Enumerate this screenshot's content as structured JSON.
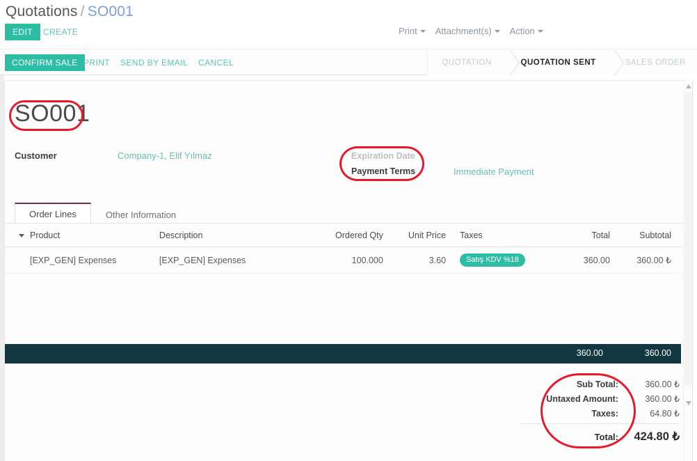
{
  "breadcrumb": {
    "root": "Quotations",
    "separator": "/",
    "current": "SO001"
  },
  "header": {
    "edit_label": "EDIT",
    "create_label": "CREATE",
    "menus": [
      {
        "label": "Print",
        "icon": "chevron-down-icon"
      },
      {
        "label": "Attachment(s)",
        "icon": "chevron-down-icon"
      },
      {
        "label": "Action",
        "icon": "chevron-down-icon"
      }
    ]
  },
  "statusbar": {
    "primary_action": "CONFIRM SALE",
    "actions": [
      {
        "label": "PRINT"
      },
      {
        "label": "SEND BY EMAIL"
      },
      {
        "label": "CANCEL"
      }
    ],
    "pipeline": [
      {
        "label": "QUOTATION",
        "active": false
      },
      {
        "label": "QUOTATION SENT",
        "active": true
      },
      {
        "label": "SALES ORDER",
        "active": false
      }
    ]
  },
  "document": {
    "title": "SO001",
    "fields": {
      "customer_label": "Customer",
      "customer_value": "Company-1, Elif Yılmaz",
      "expiration_label": "Expiration Date",
      "expiration_value": "",
      "payment_terms_label": "Payment Terms",
      "payment_terms_value": "Immediate Payment"
    }
  },
  "tabs": [
    {
      "label": "Order Lines",
      "active": true
    },
    {
      "label": "Other Information",
      "active": false
    }
  ],
  "lines_table": {
    "columns": [
      "Product",
      "Description",
      "Ordered Qty",
      "Unit Price",
      "Taxes",
      "Total",
      "Subtotal"
    ],
    "rows": [
      {
        "product": "[EXP_GEN] Expenses",
        "description": "[EXP_GEN] Expenses",
        "ordered_qty": "100.000",
        "unit_price": "3.60",
        "taxes": "Satış KDV %18",
        "total": "360.00",
        "subtotal": "360.00 ₺"
      }
    ],
    "footer": {
      "total": "360.00",
      "subtotal": "360.00"
    }
  },
  "totals": [
    {
      "label": "Sub Total:",
      "value": "360.00 ₺",
      "grand": false
    },
    {
      "label": "Untaxed Amount:",
      "value": "360.00 ₺",
      "grand": false
    },
    {
      "label": "Taxes:",
      "value": "64.80 ₺",
      "grand": false
    },
    {
      "label": "Total:",
      "value": "424.80 ₺",
      "grand": true
    }
  ],
  "colors": {
    "accent_teal": "#2dbda4",
    "link_teal": "#5ec5b0",
    "footer_bar": "#123740",
    "tab_active_border": "#7a2a52",
    "annotation_red": "#e8192c",
    "breadcrumb_link": "#7e9fd6"
  }
}
